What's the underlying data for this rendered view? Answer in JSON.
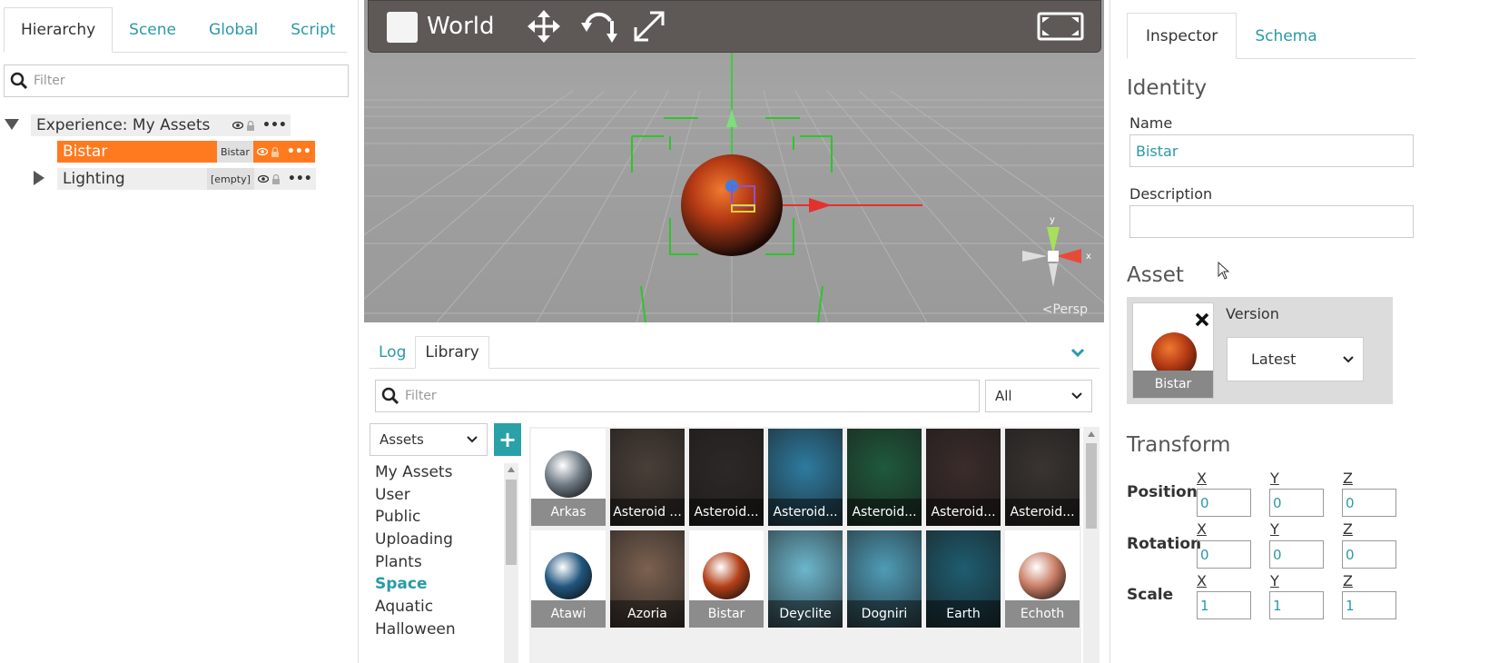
{
  "left": {
    "tabs": [
      "Hierarchy",
      "Scene",
      "Global",
      "Script"
    ],
    "filter_placeholder": "Filter",
    "tree": {
      "root": {
        "label": "Experience: My Assets"
      },
      "bistar": {
        "label": "Bistar",
        "badge": "Bistar"
      },
      "lighting": {
        "label": "Lighting",
        "badge": "[empty]"
      },
      "more": "•••"
    }
  },
  "viewport": {
    "world_label": "World",
    "persp_label": "<Persp",
    "axis_x": "x"
  },
  "bottom": {
    "tabs": [
      "Log",
      "Library"
    ],
    "filter_placeholder": "Filter",
    "type_select": "All",
    "source_select": "Assets",
    "categories": [
      "My Assets",
      "User",
      "Public",
      "Uploading",
      "Plants",
      "Space",
      "Aquatic",
      "Halloween"
    ],
    "active_category": "Space",
    "tiles": [
      {
        "label": "Arkas",
        "color": "#6f7a84"
      },
      {
        "label": "Asteroid ...",
        "color": "#4a3f38"
      },
      {
        "label": "Asteroid...",
        "color": "#2d2826"
      },
      {
        "label": "Asteroid...",
        "color": "#2e7ba0"
      },
      {
        "label": "Asteroid...",
        "color": "#1f5a3c"
      },
      {
        "label": "Asteroid...",
        "color": "#3b2c2a"
      },
      {
        "label": "Asteroid...",
        "color": "#3a3431"
      },
      {
        "label": "Atawi",
        "color": "#21567e"
      },
      {
        "label": "Azoria",
        "color": "#7b6150"
      },
      {
        "label": "Bistar",
        "color": "#b34018"
      },
      {
        "label": "Deyclite",
        "color": "#6db6cc"
      },
      {
        "label": "Dogniri",
        "color": "#4f9cb7"
      },
      {
        "label": "Earth",
        "color": "#1e5d70"
      },
      {
        "label": "Echoth",
        "color": "#c87c63"
      }
    ]
  },
  "right": {
    "tabs": [
      "Inspector",
      "Schema"
    ],
    "identity_title": "Identity",
    "name_label": "Name",
    "name_value": "Bistar",
    "description_label": "Description",
    "description_value": "",
    "asset_title": "Asset",
    "asset_thumb_label": "Bistar",
    "version_label": "Version",
    "version_value": "Latest",
    "transform_title": "Transform",
    "axes": [
      "X",
      "Y",
      "Z"
    ],
    "position_label": "Position",
    "rotation_label": "Rotation",
    "scale_label": "Scale",
    "position": [
      "0",
      "0",
      "0"
    ],
    "rotation": [
      "0",
      "0",
      "0"
    ],
    "scale": [
      "1",
      "1",
      "1"
    ]
  },
  "colors": {
    "accent": "#2a9aa6",
    "selection": "#ff7a1f"
  }
}
